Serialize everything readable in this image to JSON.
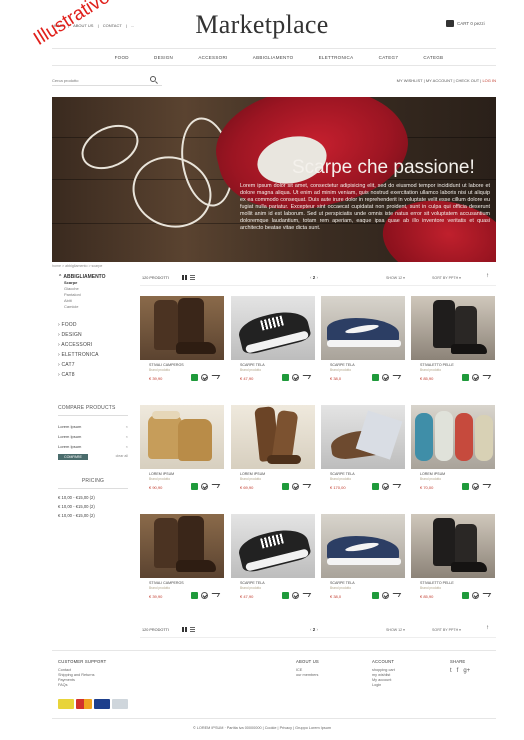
{
  "header": {
    "topnav": [
      "HOME",
      "|",
      "ABOUT US",
      "|",
      "CONTACT",
      "|",
      "..."
    ],
    "brand": "Marketplace",
    "cart_label": "CART 0 pezzi",
    "watermark": "Illustrativo"
  },
  "categories": [
    "FOOD",
    "DESIGN",
    "ACCESSORI",
    "ABBIGLIAMENTO",
    "ELETTRONICA",
    "CATEG7",
    "CATEGB"
  ],
  "search": {
    "placeholder": "Cerca prodotto"
  },
  "account_links": {
    "wishlist": "MY WISHLIST",
    "sep": "|",
    "account": "MY ACCOUNT",
    "checkout": "CHECK OUT",
    "login": "LOG IN"
  },
  "hero": {
    "title": "Scarpe che passione!",
    "text": "Lorem ipsum dolor sit amet, consectetur adipisicing elit, sed do eiusmod tempor incididunt ut labore et dolore magna aliqua. Ut enim ad minim veniam, quis nostrud exercitation ullamco laboris nisi ut aliquip ex ea commodo consequat. Duis aute irure dolor in reprehenderit in voluptate velit esse cillum dolore eu fugiat nulla pariatur. Excepteur sint occaecat cupidatat non proident, sunt in culpa qui officia deserunt mollit anim id est laborum. Sed ut perspiciatis unde omnis iste natus error sit voluptatem accusantium doloremque laudantium, totam rem aperiam, eaque ipsa quae ab illo inventore veritatis et quasi architecto beatae vitae dicta sunt."
  },
  "breadcrumb": "home  >  abbigliamento  >  scarpe",
  "sidebar": {
    "main": "ABBIGLIAMENTO",
    "subs": [
      {
        "label": "Scarpe",
        "active": true
      },
      {
        "label": "Giacche",
        "active": false
      },
      {
        "label": "Pantaloni",
        "active": false
      },
      {
        "label": "Abiti",
        "active": false
      },
      {
        "label": "Camicie",
        "active": false
      }
    ],
    "cats": [
      "FOOD",
      "DESIGN",
      "ACCESSORI",
      "ELETTRONICA",
      "CAT7",
      "CAT8"
    ]
  },
  "compare": {
    "title": "COMPARE PRODUCTS",
    "items": [
      "Lorem Ipsum",
      "Lorem Ipsum",
      "Lorem Ipsum"
    ],
    "remove_glyph": "×",
    "button": "COMPARE",
    "cancel": "clear all"
  },
  "pricing": {
    "title": "PRICING",
    "ranges": [
      "€ 10,00 - €15,00 (2)",
      "€ 10,00 - €15,00 (2)",
      "€ 10,00 - €15,00 (2)"
    ]
  },
  "toolbar": {
    "count": "120 PRODOTTI",
    "pager_prev": "‹",
    "pager_page": "2",
    "pager_next": "›",
    "show": "SHOW  12  ▾",
    "sort": "SORT BY  PPTH  ▾",
    "sort_dir": "↑"
  },
  "products": [
    {
      "name": "STIVALI CAMPEROS",
      "brand": "Brand prodotto",
      "price": "€ 39,90",
      "style": "boot-brown",
      "bg": "bg-wood"
    },
    {
      "name": "SCARPE TELA",
      "brand": "Brand prodotto",
      "price": "€ 47,90",
      "style": "sneaker-bw",
      "bg": "bg-grey"
    },
    {
      "name": "SCARPE TELA",
      "brand": "Brand prodotto",
      "price": "€ 38,0",
      "style": "sneaker-navy",
      "bg": "bg-stone"
    },
    {
      "name": "STIVALETTO PELLE",
      "brand": "Brand prodotto",
      "price": "€ 85,90",
      "style": "boot-black",
      "bg": "bg-dark"
    },
    {
      "name": "LOREM IPSUM",
      "brand": "Brand prodotto",
      "price": "€ 90,90",
      "style": "boot-tan",
      "bg": "bg-cream"
    },
    {
      "name": "LOREM IPSUM",
      "brand": "Brand prodotto",
      "price": "€ 69,90",
      "style": "boot-tall",
      "bg": "bg-cream"
    },
    {
      "name": "SCARPE TELA",
      "brand": "Brand prodotto",
      "price": "€ 170,00",
      "style": "moc-brown",
      "bg": "bg-grey"
    },
    {
      "name": "LOREM IPSUM",
      "brand": "Brand prodotto",
      "price": "€ 70,00",
      "style": "sneaker-color",
      "bg": "bg-stone"
    },
    {
      "name": "STIVALI CAMPEROS",
      "brand": "Brand prodotto",
      "price": "€ 39,90",
      "style": "boot-brown",
      "bg": "bg-wood"
    },
    {
      "name": "SCARPE TELA",
      "brand": "Brand prodotto",
      "price": "€ 47,90",
      "style": "sneaker-bw",
      "bg": "bg-grey"
    },
    {
      "name": "SCARPE TELA",
      "brand": "Brand prodotto",
      "price": "€ 38,0",
      "style": "sneaker-navy",
      "bg": "bg-stone"
    },
    {
      "name": "STIVALETTO PELLE",
      "brand": "Brand prodotto",
      "price": "€ 85,90",
      "style": "boot-black",
      "bg": "bg-dark"
    }
  ],
  "footer": {
    "support_title": "CUSTOMER SUPPORT",
    "support_links": [
      "Contact",
      "Shipping and Returns",
      "Payments",
      "FAQs"
    ],
    "about_title": "ABOUT US",
    "about_links": [
      "ICE",
      "our members"
    ],
    "account_title": "ACCOUNT",
    "account_links": [
      "shopping cart",
      "my wishlist",
      "My account",
      "Login"
    ],
    "share_title": "SHARE",
    "share_icons": [
      "t",
      "f",
      "g+"
    ],
    "copyright": "© LOREM IPSUM · Partita iva 00000000  |  Cookie  |  Privacy  |  Gruppo Lorem Ipsum"
  },
  "colors": {
    "accent_red": "#c0392b",
    "cart_green": "#1f9a3b",
    "compare_btn": "#4a6c6c"
  }
}
